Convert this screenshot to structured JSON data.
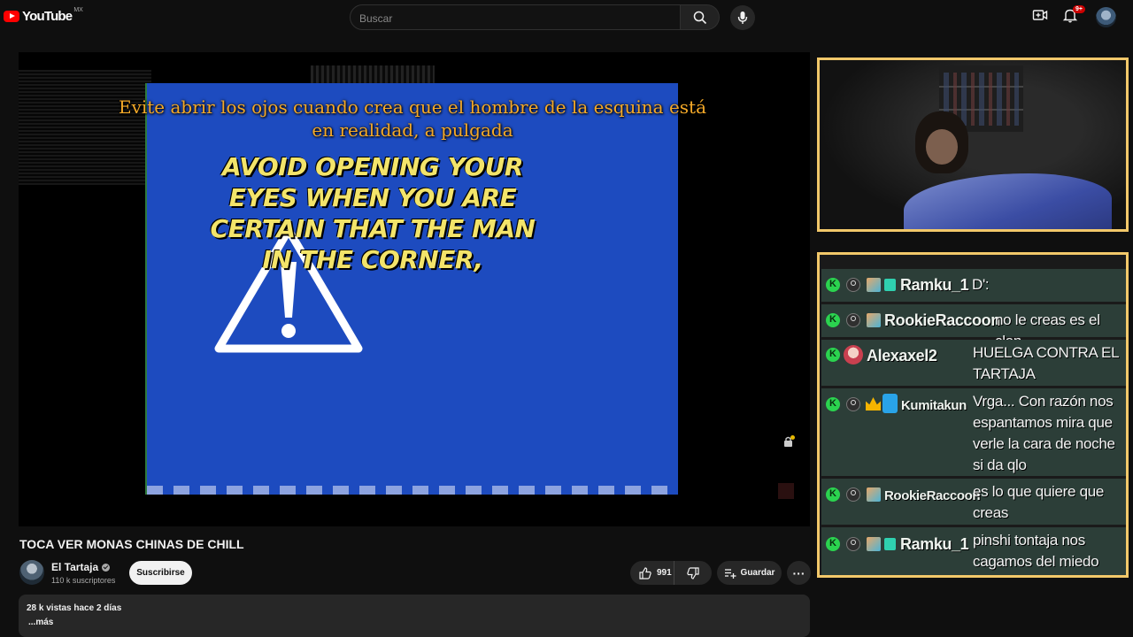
{
  "header": {
    "logo_text": "YouTube",
    "country": "MX",
    "search_placeholder": "Buscar",
    "notifications_badge": "9+"
  },
  "video": {
    "subtitle_es": "Evite abrir los ojos cuando crea que el hombre de la esquina está en realidad, a pulgada",
    "screen_text": "AVOID OPENING YOUR EYES WHEN YOU ARE CERTAIN THAT THE MAN IN THE CORNER,",
    "title": "TOCA VER MONAS CHINAS DE CHILL"
  },
  "channel": {
    "name": "El Tartaja",
    "subscribers": "110 k suscriptores",
    "subscribe_label": "Suscribirse"
  },
  "actions": {
    "likes": "991",
    "save_label": "Guardar",
    "more_label": "···"
  },
  "description": {
    "meta": "28 k vistas  hace 2 días",
    "more": "...más"
  },
  "chat": {
    "messages": [
      {
        "user": "Ramku_1",
        "text": "D':"
      },
      {
        "user": "RookieRaccoon",
        "text": "no le creas es el clon"
      },
      {
        "user": "Alexaxel2",
        "text": "HUELGA CONTRA EL TARTAJA"
      },
      {
        "user": "Kumitakun",
        "text": "Vrga... Con razón nos espantamos mira que verle la cara de noche si da qlo"
      },
      {
        "user": "RookieRaccoon",
        "text": "es lo que quiere que creas"
      },
      {
        "user": "Ramku_1",
        "text": "pinshi tontaja nos cagamos del miedo"
      }
    ]
  },
  "colors": {
    "background": "#0f0f0f",
    "accent_red": "#ff0000",
    "overlay_border": "#f2c86a",
    "chat_row": "#2c3e38",
    "screen_blue": "#1d4bbf",
    "subtitle_orange": "#f4a928",
    "screen_text_yellow": "#f3e46a"
  },
  "icons": [
    "youtube-logo-icon",
    "search-icon",
    "mic-icon",
    "create-icon",
    "bell-icon",
    "like-icon",
    "dislike-icon",
    "save-icon",
    "more-icon",
    "warning-icon",
    "kick-icon",
    "user-icon",
    "gift-icon",
    "crown-icon"
  ]
}
